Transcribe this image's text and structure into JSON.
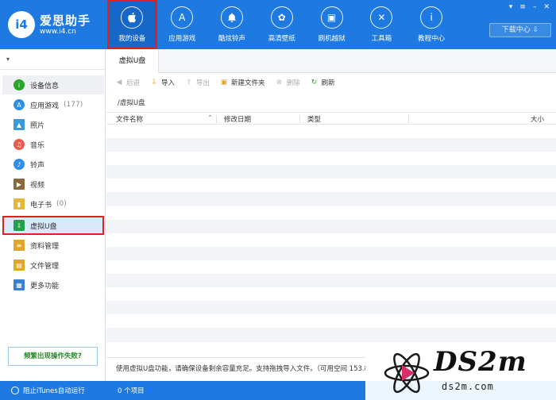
{
  "app": {
    "name": "爱思助手",
    "url": "www.i4.cn",
    "badge": "i4"
  },
  "nav": [
    {
      "label": "我的设备",
      "icon": "apple-icon",
      "glyph": "",
      "active": true
    },
    {
      "label": "应用游戏",
      "icon": "app-store-icon",
      "glyph": "A"
    },
    {
      "label": "酷炫铃声",
      "icon": "bell-icon",
      "glyph": "♪"
    },
    {
      "label": "高清壁纸",
      "icon": "flower-icon",
      "glyph": "✿"
    },
    {
      "label": "刷机越狱",
      "icon": "box-icon",
      "glyph": "▣"
    },
    {
      "label": "工具箱",
      "icon": "tools-icon",
      "glyph": "✕"
    },
    {
      "label": "教程中心",
      "icon": "info-icon",
      "glyph": "i"
    }
  ],
  "header": {
    "download_center": "下载中心 ⇩"
  },
  "sidebar": {
    "device_toggle": "▾",
    "items": [
      {
        "label": "设备信息",
        "icon": "info-icon",
        "color": "#2aa52a",
        "glyph": "i",
        "count": ""
      },
      {
        "label": "应用游戏",
        "icon": "app-store-icon",
        "color": "#2f8fe6",
        "glyph": "A",
        "count": "(177)"
      },
      {
        "label": "照片",
        "icon": "photo-icon",
        "color": "#3a9ad9",
        "glyph": "▲",
        "count": ""
      },
      {
        "label": "音乐",
        "icon": "music-icon",
        "color": "#e95a4f",
        "glyph": "♫",
        "count": ""
      },
      {
        "label": "铃声",
        "icon": "bell-icon",
        "color": "#2f8fe6",
        "glyph": "♪",
        "count": ""
      },
      {
        "label": "视频",
        "icon": "video-icon",
        "color": "#8a6a3a",
        "glyph": "▶",
        "count": ""
      },
      {
        "label": "电子书",
        "icon": "book-icon",
        "color": "#e2b73a",
        "glyph": "▮",
        "count": "(0)"
      },
      {
        "label": "虚拟U盘",
        "icon": "usb-disk-icon",
        "color": "#25a04a",
        "glyph": "⇩",
        "count": ""
      },
      {
        "label": "资料管理",
        "icon": "document-icon",
        "color": "#e0a52a",
        "glyph": "≡",
        "count": ""
      },
      {
        "label": "文件管理",
        "icon": "folder-icon",
        "color": "#e0a52a",
        "glyph": "▤",
        "count": ""
      },
      {
        "label": "更多功能",
        "icon": "grid-icon",
        "color": "#3a7fd0",
        "glyph": "▦",
        "count": ""
      }
    ],
    "problem_link": "频繁出现操作失败?"
  },
  "tab": {
    "label": "虚拟U盘"
  },
  "toolbar": {
    "back": "后退",
    "import": "导入",
    "export": "导出",
    "new_folder": "新建文件夹",
    "delete": "删除",
    "refresh": "刷新"
  },
  "path": "/虚拟U盘",
  "table": {
    "columns": [
      "文件名称",
      "修改日期",
      "类型",
      "大小"
    ],
    "rows": []
  },
  "infobar": {
    "text": "使用虚拟U盘功能，请确保设备剩余容量充足。支持拖拽导入文件。（可用空间 153.8"
  },
  "status": {
    "itunes_block": "阻止iTunes自动运行",
    "item_count": "0 个项目"
  },
  "watermark": {
    "brand": "DS2m",
    "domain": "ds2m.com"
  }
}
